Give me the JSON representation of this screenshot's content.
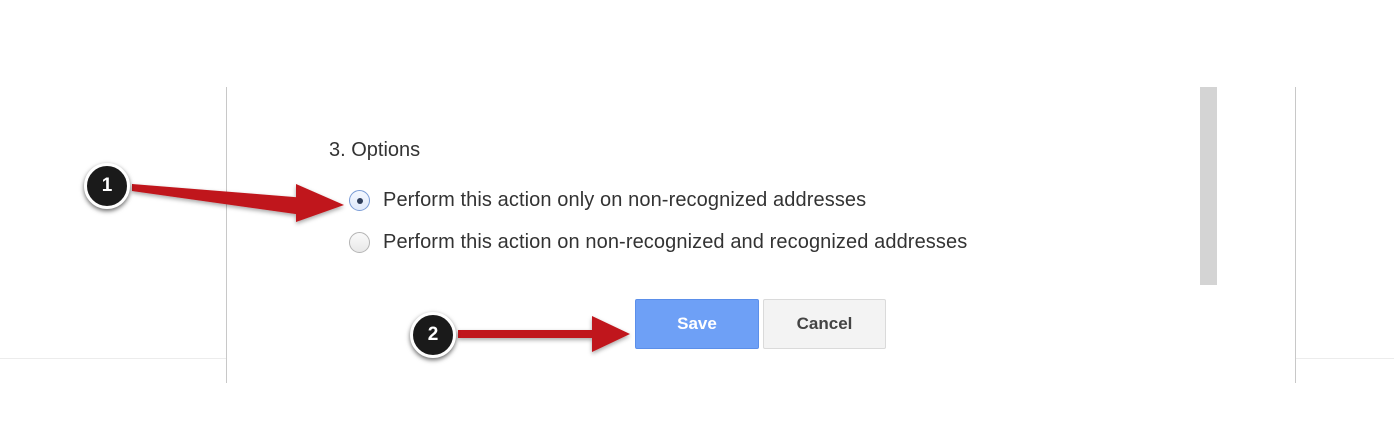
{
  "dialog": {
    "section_title": "3. Options",
    "options": [
      {
        "label": "Perform this action only on non-recognized addresses",
        "selected": true
      },
      {
        "label": "Perform this action on non-recognized and recognized addresses",
        "selected": false
      }
    ],
    "buttons": {
      "save_label": "Save",
      "cancel_label": "Cancel"
    }
  },
  "annotations": {
    "callouts": [
      "1",
      "2"
    ],
    "arrow_color": "#c0141b"
  },
  "colors": {
    "save_button": "#6ea0f6",
    "callout_bg": "#1a1a1a"
  }
}
